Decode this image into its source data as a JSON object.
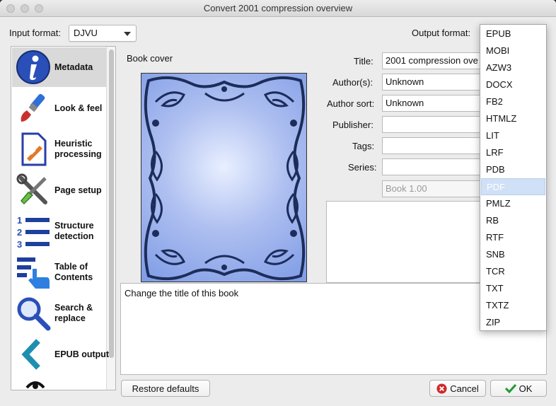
{
  "window": {
    "title": "Convert 2001 compression overview"
  },
  "input_format": {
    "label": "Input format:",
    "value": "DJVU"
  },
  "output_format": {
    "label": "Output format:"
  },
  "sidebar": {
    "items": [
      {
        "label": "Metadata",
        "icon": "info-icon"
      },
      {
        "label": "Look & feel",
        "icon": "paintbrush-icon"
      },
      {
        "label": "Heuristic processing",
        "icon": "heuristic-document-icon"
      },
      {
        "label": "Page setup",
        "icon": "tools-icon"
      },
      {
        "label": "Structure detection",
        "icon": "numbered-list-icon"
      },
      {
        "label": "Table of Contents",
        "icon": "toc-icon"
      },
      {
        "label": "Search & replace",
        "icon": "magnifier-icon"
      },
      {
        "label": "EPUB output",
        "icon": "chevron-left-icon"
      }
    ]
  },
  "cover": {
    "label": "Book cover"
  },
  "metadata": {
    "title": {
      "label": "Title:",
      "value": "2001 compression ove"
    },
    "authors": {
      "label": "Author(s):",
      "value": "Unknown"
    },
    "author_sort": {
      "label": "Author sort:",
      "value": "Unknown"
    },
    "publisher": {
      "label": "Publisher:",
      "value": ""
    },
    "tags": {
      "label": "Tags:",
      "value": ""
    },
    "series": {
      "label": "Series:",
      "value": ""
    },
    "series_index": {
      "value": "Book 1.00"
    }
  },
  "help_text": "Change the title of this book",
  "buttons": {
    "restore": "Restore defaults",
    "cancel": "Cancel",
    "ok": "OK"
  },
  "output_options": [
    "EPUB",
    "MOBI",
    "AZW3",
    "DOCX",
    "FB2",
    "HTMLZ",
    "LIT",
    "LRF",
    "PDB",
    "PDF",
    "PMLZ",
    "RB",
    "RTF",
    "SNB",
    "TCR",
    "TXT",
    "TXTZ",
    "ZIP"
  ],
  "output_selected": "PDF",
  "colors": {
    "cover_blue": "#7e9be6",
    "ornament": "#1c2d5a",
    "highlight": "#cfe0f7",
    "cancel_red": "#d0282a",
    "ok_green": "#1e9a32"
  }
}
